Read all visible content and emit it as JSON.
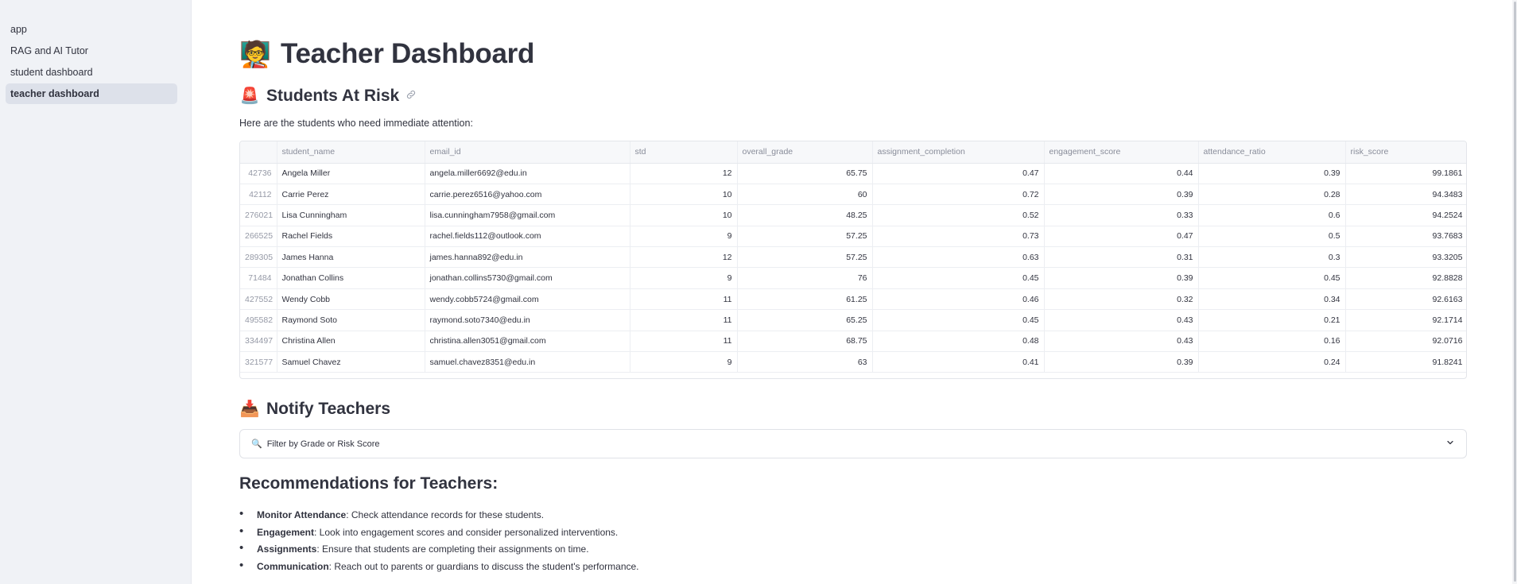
{
  "sidebar": {
    "items": [
      {
        "label": "app"
      },
      {
        "label": "RAG and AI Tutor"
      },
      {
        "label": "student dashboard"
      },
      {
        "label": "teacher dashboard"
      }
    ]
  },
  "page": {
    "title_emoji": "🧑‍🏫",
    "title": "Teacher Dashboard"
  },
  "at_risk": {
    "emoji": "🚨",
    "heading": "Students At Risk",
    "link_icon": "link-icon",
    "intro": "Here are the students who need immediate attention:"
  },
  "table": {
    "columns": [
      "",
      "student_name",
      "email_id",
      "std",
      "overall_grade",
      "assignment_completion",
      "engagement_score",
      "attendance_ratio",
      "risk_score"
    ],
    "rows": [
      [
        "42736",
        "Angela Miller",
        "angela.miller6692@edu.in",
        "12",
        "65.75",
        "0.47",
        "0.44",
        "0.39",
        "99.1861"
      ],
      [
        "42112",
        "Carrie Perez",
        "carrie.perez6516@yahoo.com",
        "10",
        "60",
        "0.72",
        "0.39",
        "0.28",
        "94.3483"
      ],
      [
        "276021",
        "Lisa Cunningham",
        "lisa.cunningham7958@gmail.com",
        "10",
        "48.25",
        "0.52",
        "0.33",
        "0.6",
        "94.2524"
      ],
      [
        "266525",
        "Rachel Fields",
        "rachel.fields112@outlook.com",
        "9",
        "57.25",
        "0.73",
        "0.47",
        "0.5",
        "93.7683"
      ],
      [
        "289305",
        "James Hanna",
        "james.hanna892@edu.in",
        "12",
        "57.25",
        "0.63",
        "0.31",
        "0.3",
        "93.3205"
      ],
      [
        "71484",
        "Jonathan Collins",
        "jonathan.collins5730@gmail.com",
        "9",
        "76",
        "0.45",
        "0.39",
        "0.45",
        "92.8828"
      ],
      [
        "427552",
        "Wendy Cobb",
        "wendy.cobb5724@gmail.com",
        "11",
        "61.25",
        "0.46",
        "0.32",
        "0.34",
        "92.6163"
      ],
      [
        "495582",
        "Raymond Soto",
        "raymond.soto7340@edu.in",
        "11",
        "65.25",
        "0.45",
        "0.43",
        "0.21",
        "92.1714"
      ],
      [
        "334497",
        "Christina Allen",
        "christina.allen3051@gmail.com",
        "11",
        "68.75",
        "0.48",
        "0.43",
        "0.16",
        "92.0716"
      ],
      [
        "321577",
        "Samuel Chavez",
        "samuel.chavez8351@edu.in",
        "9",
        "63",
        "0.41",
        "0.39",
        "0.24",
        "91.8241"
      ]
    ]
  },
  "notify": {
    "emoji": "📥",
    "heading": "Notify Teachers",
    "expander_icon": "🔍",
    "expander_label": "Filter by Grade or Risk Score"
  },
  "recommendations": {
    "title": "Recommendations for Teachers:",
    "items": [
      {
        "bold": "Monitor Attendance",
        "text": ": Check attendance records for these students."
      },
      {
        "bold": "Engagement",
        "text": ": Look into engagement scores and consider personalized interventions."
      },
      {
        "bold": "Assignments",
        "text": ": Ensure that students are completing their assignments on time."
      },
      {
        "bold": "Communication",
        "text": ": Reach out to parents or guardians to discuss the student's performance."
      }
    ]
  }
}
